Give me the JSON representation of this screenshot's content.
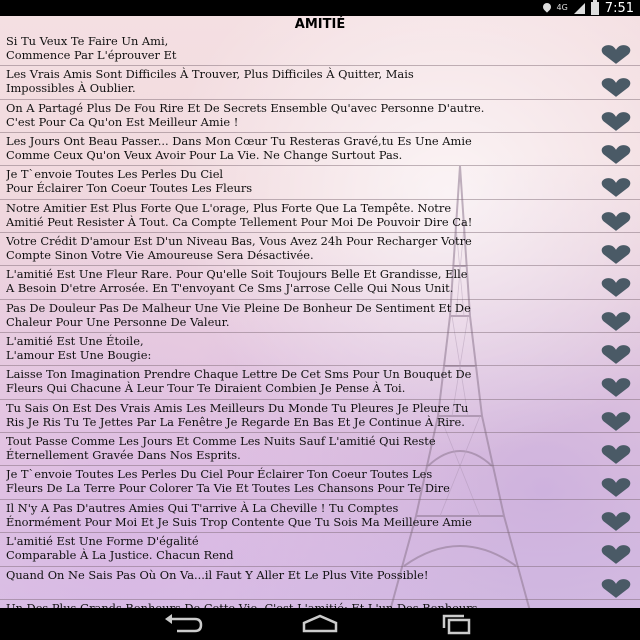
{
  "status_bar": {
    "network_label": "4G",
    "time": "7:51",
    "icons": [
      "location-icon",
      "signal-icon",
      "battery-icon"
    ]
  },
  "app": {
    "title": "AMITIÉ"
  },
  "colors": {
    "heart": "#4a5a66",
    "text": "#111111",
    "status_bar": "#000000"
  },
  "quotes": [
    {
      "text": "Si Tu Veux Te Faire Un Ami,\nCommence Par L'éprouver Et"
    },
    {
      "text": "Les Vrais Amis Sont Difficiles À Trouver,  Plus Difficiles À Quitter,  Mais\nImpossibles À Oublier."
    },
    {
      "text": "On A Partagé Plus De Fou Rire Et De Secrets Ensemble Qu'avec Personne D'autre.\nC'est Pour Ca Qu'on Est Meilleur Amie !"
    },
    {
      "text": "Les Jours Ont Beau Passer... Dans Mon Cœur Tu Resteras Gravé,tu Es Une Amie\nComme Ceux Qu'on Veux Avoir Pour La Vie. Ne Change Surtout Pas."
    },
    {
      "text": "Je T`envoie Toutes Les Perles Du Ciel\nPour Éclairer Ton Coeur Toutes Les Fleurs"
    },
    {
      "text": "Notre Amitier Est Plus Forte Que L'orage, Plus Forte Que La Tempête. Notre\nAmitié Peut Resister À Tout. Ca Compte Tellement Pour Moi De Pouvoir Dire Ca!"
    },
    {
      "text": "Votre Crédit D'amour Est D'un Niveau Bas, Vous Avez 24h Pour Recharger Votre\nCompte Sinon Votre Vie Amoureuse Sera Désactivée."
    },
    {
      "text": "L'amitié Est Une Fleur Rare.  Pour Qu'elle Soit Toujours Belle Et Grandisse,  Elle\nA Besoin D'etre Arrosée.  En T'envoyant Ce Sms J'arrose Celle Qui Nous Unit."
    },
    {
      "text": "Pas De Douleur Pas De Malheur Une Vie Pleine De Bonheur De Sentiment Et De\nChaleur Pour Une Personne De Valeur."
    },
    {
      "text": "L'amitié Est Une Étoile,\nL'amour Est Une Bougie:"
    },
    {
      "text": "Laisse Ton Imagination Prendre Chaque Lettre De Cet Sms Pour Un Bouquet De\nFleurs Qui Chacune À Leur Tour Te Diraient Combien Je Pense À Toi."
    },
    {
      "text": "Tu Sais On Est Des Vrais Amis Les Meilleurs Du Monde Tu Pleures Je Pleure Tu\nRis Je Ris Tu Te Jettes Par La Fenêtre Je Regarde En Bas Et Je Continue À Rire."
    },
    {
      "text": "Tout Passe Comme Les Jours Et Comme Les Nuits Sauf L'amitié Qui Reste\nÉternellement Gravée Dans Nos Esprits."
    },
    {
      "text": "Je T`envoie Toutes Les Perles Du Ciel  Pour Éclairer Ton Coeur Toutes Les\nFleurs  De La Terre Pour Colorer Ta Vie Et Toutes  Les Chansons Pour Te Dire"
    },
    {
      "text": "Il N'y A Pas D'autres Amies Qui T'arrive À La Cheville ! Tu Comptes\nÉnormément Pour Moi Et Je Suis Trop Contente Que Tu Sois Ma Meilleure Amie"
    },
    {
      "text": "L'amitié Est Une Forme D'égalité\nComparable À La Justice. Chacun Rend"
    },
    {
      "text": "Quand On Ne Sais Pas Où On Va...il Faut Y Aller Et Le Plus Vite Possible!"
    },
    {
      "text": "Un Des Plus Grands Bonheurs De Cette Vie, C'est L'amitié; Et L'un Des Bonheurs"
    }
  ],
  "nav_bar": {
    "buttons": [
      "back-icon",
      "home-icon",
      "recent-apps-icon"
    ]
  }
}
